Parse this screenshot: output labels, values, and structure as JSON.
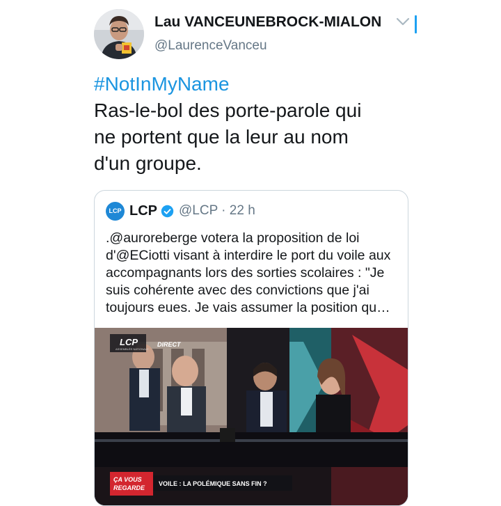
{
  "tweet": {
    "author_name": "Lau VANCEUNEBROCK-MIALON",
    "author_handle": "@LaurenceVanceu",
    "hashtag": "#NotInMyName",
    "text_lines": [
      "Ras-le-bol des porte-parole qui",
      "ne portent que la leur au nom",
      "d'un groupe."
    ]
  },
  "quoted_tweet": {
    "logo_text": "LCP",
    "author_name": "LCP",
    "handle_time": "@LCP · 22 h",
    "text_lines": [
      ".@auroreberge votera la proposition de loi",
      "d'@ECiotti visant à interdire le port du voile aux",
      "accompagnants lors des sorties scolaires : \"Je",
      "suis cohérente avec des convictions que j'ai",
      "toujours eues. Je vais assumer la position qu…"
    ],
    "media": {
      "channel_logo": "LCP",
      "channel_sub": "ASSEMBLÉE NATIONALE",
      "live_label": "DIRECT",
      "show_name_line1": "ÇA VOUS",
      "show_name_line2": "REGARDE",
      "banner_text": "VOILE : LA POLÉMIQUE SANS FIN ?"
    }
  },
  "colors": {
    "accent": "#1da1f2",
    "hashtag": "#1b95e0",
    "muted": "#657786",
    "border": "#ccd6dd"
  },
  "icons": [
    "chevron-down-icon",
    "verified-badge-icon",
    "lcp-logo-icon"
  ]
}
